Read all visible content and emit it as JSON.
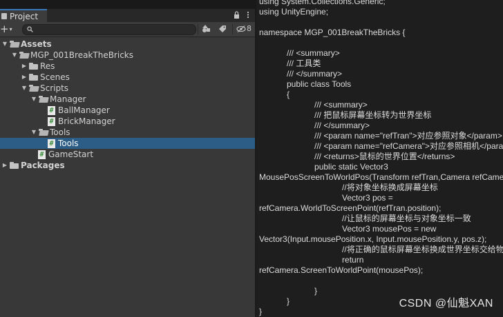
{
  "project_panel": {
    "tab_label": "Project",
    "lock_icon": "lock-icon",
    "menu_icon": "kebab-icon",
    "add_label": "+",
    "search_placeholder": "",
    "hidden_count": "8"
  },
  "tree": [
    {
      "label": "Assets",
      "indent": 0,
      "expanded": true,
      "type": "folder",
      "bold": true
    },
    {
      "label": "MGP_001BreakTheBricks",
      "indent": 1,
      "expanded": true,
      "type": "folder"
    },
    {
      "label": "Res",
      "indent": 2,
      "expanded": false,
      "type": "folder"
    },
    {
      "label": "Scenes",
      "indent": 2,
      "expanded": false,
      "type": "folder"
    },
    {
      "label": "Scripts",
      "indent": 2,
      "expanded": true,
      "type": "folder"
    },
    {
      "label": "Manager",
      "indent": 3,
      "expanded": true,
      "type": "folder"
    },
    {
      "label": "BallManager",
      "indent": 4,
      "type": "script"
    },
    {
      "label": "BrickManager",
      "indent": 4,
      "type": "script"
    },
    {
      "label": "Tools",
      "indent": 3,
      "expanded": true,
      "type": "folder"
    },
    {
      "label": "Tools",
      "indent": 4,
      "type": "script",
      "selected": true
    },
    {
      "label": "GameStart",
      "indent": 3,
      "type": "script"
    },
    {
      "label": "Packages",
      "indent": 0,
      "expanded": false,
      "type": "folder",
      "bold": true
    }
  ],
  "code_lines": [
    "using System.Collections.Generic;",
    "using UnityEngine;",
    "",
    "namespace MGP_001BreakTheBricks {",
    "",
    "            /// <summary>",
    "            /// 工具类",
    "            /// </summary>",
    "            public class Tools",
    "            {",
    "                        /// <summary>",
    "                        /// 把鼠标屏幕坐标转为世界坐标",
    "                        /// </summary>",
    "                        /// <param name=\"refTran\">对应参照对象</param>",
    "                        /// <param name=\"refCamera\">对应参照相机</param>",
    "                        /// <returns>鼠标的世界位置</returns>",
    "                        public static Vector3",
    "MousePosScreenToWorldPos(Transform refTran,Camera refCamera)",
    "                                    //将对象坐标换成屏幕坐标",
    "                                    Vector3 pos =",
    "refCamera.WorldToScreenPoint(refTran.position);",
    "                                    //让鼠标的屏幕坐标与对象坐标一致",
    "                                    Vector3 mousePos = new",
    "Vector3(Input.mousePosition.x, Input.mousePosition.y, pos.z);",
    "                                    //将正确的鼠标屏幕坐标换成世界坐标交给物体",
    "                                    return",
    "refCamera.ScreenToWorldPoint(mousePos);",
    "",
    "                        }",
    "            }",
    "}"
  ],
  "watermark": "CSDN @仙魁XAN"
}
